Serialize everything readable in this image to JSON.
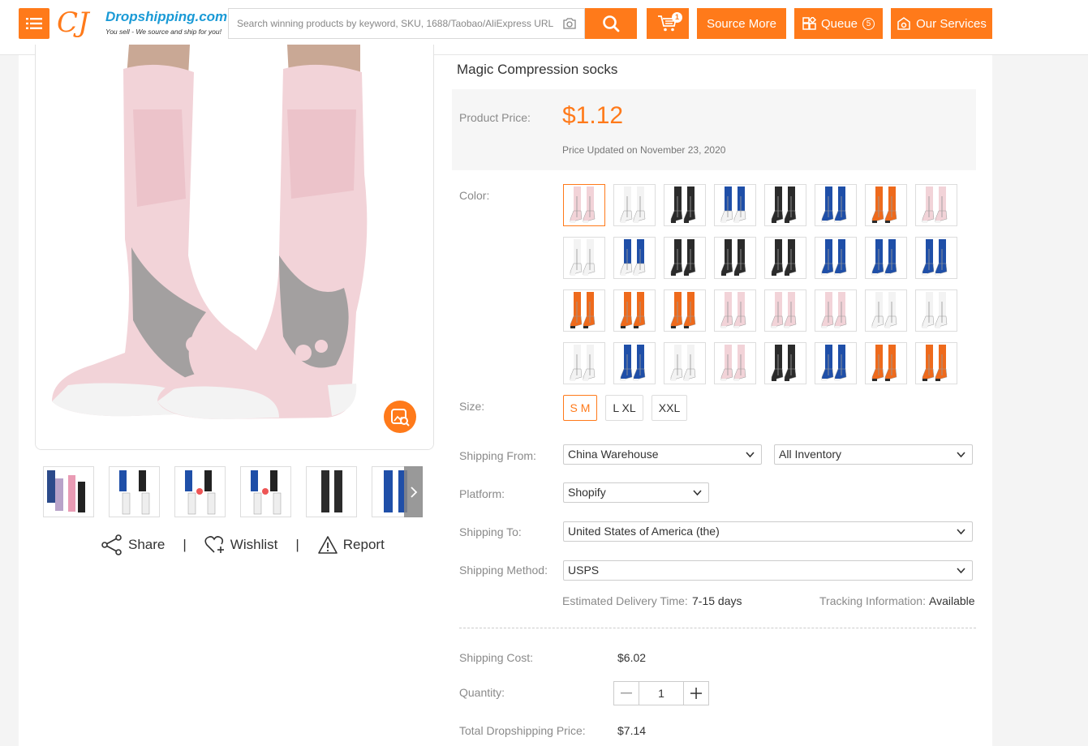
{
  "header": {
    "logo_name": "Dropshipping.com",
    "logo_tagline": "You sell - We source and ship for you!",
    "search_placeholder": "Search winning products by keyword, SKU, 1688/Taobao/AliExpress URL",
    "cart_count": "1",
    "source_more": "Source More",
    "queue_label": "Queue",
    "queue_count": "5",
    "services_label": "Our Services"
  },
  "gallery": {
    "share": "Share",
    "wishlist": "Wishlist",
    "report": "Report",
    "separator": "|"
  },
  "product": {
    "title": "Magic Compression socks",
    "price_label": "Product Price:",
    "price": "$1.12",
    "price_updated": "Price Updated on November 23, 2020",
    "color_label": "Color:",
    "size_label": "Size:",
    "sizes": [
      "S M",
      "L XL",
      "XXL"
    ],
    "selected_size": "S M"
  },
  "shipping": {
    "from_label": "Shipping From:",
    "from_value": "China Warehouse",
    "inventory_value": "All Inventory",
    "platform_label": "Platform:",
    "platform_value": "Shopify",
    "to_label": "Shipping To:",
    "to_value": "United States of America (the)",
    "method_label": "Shipping Method:",
    "method_value": "USPS",
    "delivery_label": "Estimated Delivery Time:",
    "delivery_value": "7-15 days",
    "tracking_label": "Tracking Information:",
    "tracking_value": "Available",
    "cost_label": "Shipping Cost:",
    "cost_value": "$6.02",
    "quantity_label": "Quantity:",
    "quantity_value": "1",
    "total_label": "Total Dropshipping Price:",
    "total_value": "$7.14"
  },
  "colors": {
    "accent": "#ff7a1a",
    "sock_pink": "#f2d3d8",
    "sock_gray": "#9a9a9a",
    "sock_black": "#2b2b2b",
    "sock_blue": "#1f4fa8",
    "sock_white": "#f3f3f3",
    "sock_orange": "#ee6a1c"
  }
}
